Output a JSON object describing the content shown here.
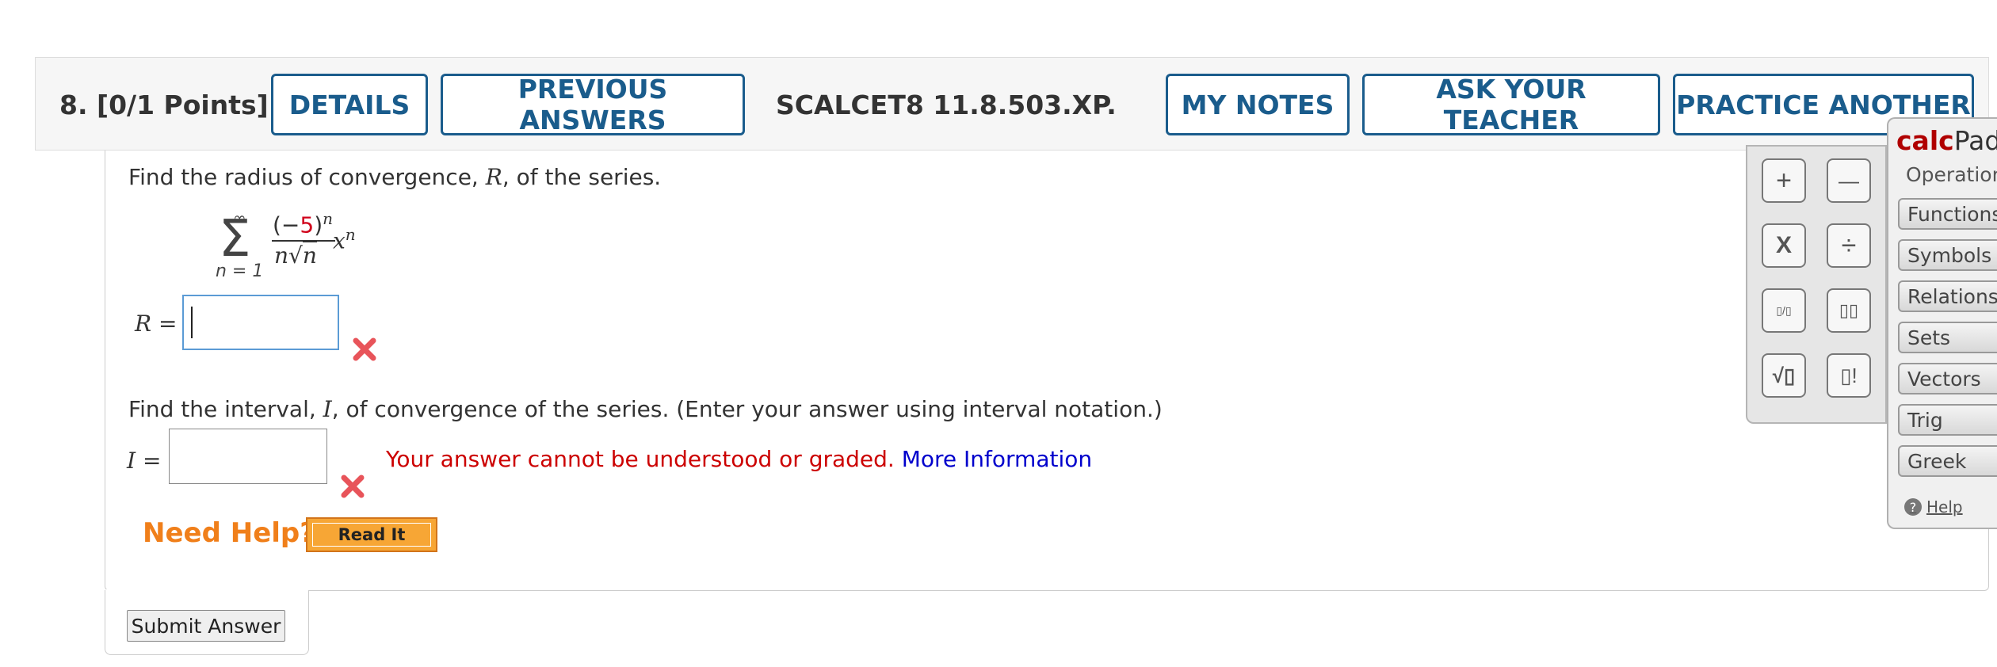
{
  "header": {
    "question_label": "8.  [0/1 Points]",
    "details": "DETAILS",
    "previous_answers": "PREVIOUS ANSWERS",
    "question_id": "SCALCET8 11.8.503.XP.",
    "my_notes": "MY NOTES",
    "ask_teacher": "ASK YOUR TEACHER",
    "practice_another": "PRACTICE ANOTHER"
  },
  "part1": {
    "prompt_before": "Find the radius of convergence, ",
    "prompt_var": "R",
    "prompt_after": ", of the series.",
    "series": {
      "sum_upper": "∞",
      "sum_lower": "n = 1",
      "num_open": "(−",
      "num_value": "5",
      "num_close": ")",
      "num_power": "n",
      "den_n": "n",
      "den_root": "√",
      "den_radicand": "n",
      "x": "x",
      "x_power": "n"
    },
    "answer_label": "R =",
    "answer_value": ""
  },
  "part2": {
    "prompt_before": "Find the interval, ",
    "prompt_var": "I",
    "prompt_after": ", of convergence of the series. (Enter your answer using interval notation.)",
    "answer_label": "I =",
    "answer_value": "",
    "error_text": "Your answer cannot be understood or graded. ",
    "more_info": "More Information"
  },
  "help": {
    "need_help": "Need Help?",
    "read_it": "Read It"
  },
  "submit_label": "Submit Answer",
  "calcpad": {
    "title_bold": "calc",
    "title_rest": "Pad",
    "keys": {
      "plus": "+",
      "minus": "—",
      "times": "X",
      "divide": "÷",
      "fraction": "▯/▯",
      "power": "▯▯",
      "sqrt": "√▯",
      "factorial": "▯!"
    },
    "tabs": [
      "Operations",
      "Functions",
      "Symbols",
      "Relations",
      "Sets",
      "Vectors",
      "Trig",
      "Greek"
    ],
    "help": "Help"
  },
  "colors": {
    "accent_blue": "#1a5c8c",
    "error_red": "#cc0000",
    "link_blue": "#0000cc",
    "help_orange": "#f07f1a",
    "highlight_red": "#d0021b"
  }
}
